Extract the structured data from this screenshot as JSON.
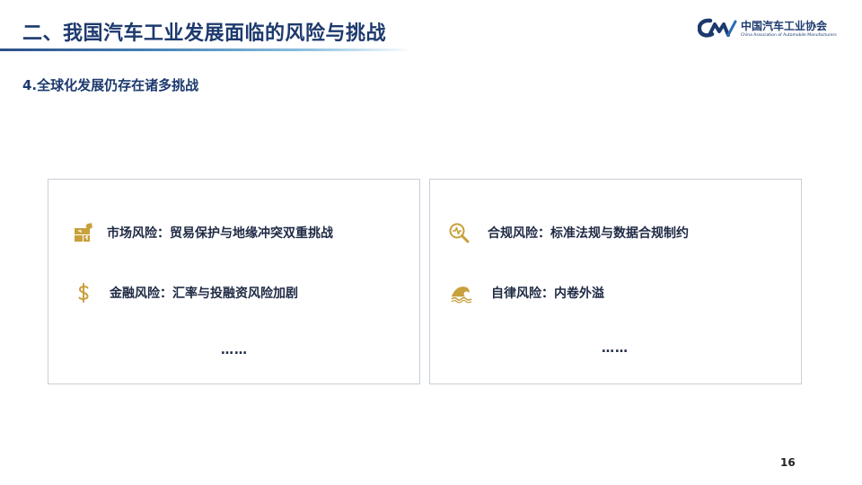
{
  "header": {
    "title": "二、我国汽车工业发展面临的风险与挑战",
    "logo_cn": "中国汽车工业协会",
    "logo_en": "China Association of Automobile Manufacturers"
  },
  "subtitle": "4.全球化发展仍存在诸多挑战",
  "left_card": {
    "items": [
      {
        "icon": "puzzle-icon",
        "text": "市场风险：贸易保护与地缘冲突双重挑战"
      },
      {
        "icon": "dollar-icon",
        "text": "金融风险：汇率与投融资风险加剧"
      }
    ],
    "ellipsis": "……"
  },
  "right_card": {
    "items": [
      {
        "icon": "magnifier-pulse-icon",
        "text": "合规风险：标准法规与数据合规制约"
      },
      {
        "icon": "wave-icon",
        "text": "自律风险：内卷外溢"
      }
    ],
    "ellipsis": "……"
  },
  "page_number": "16",
  "colors": {
    "title": "#1d3a6e",
    "icon_gold": "#c8a03c",
    "card_border": "#c9ced6"
  }
}
